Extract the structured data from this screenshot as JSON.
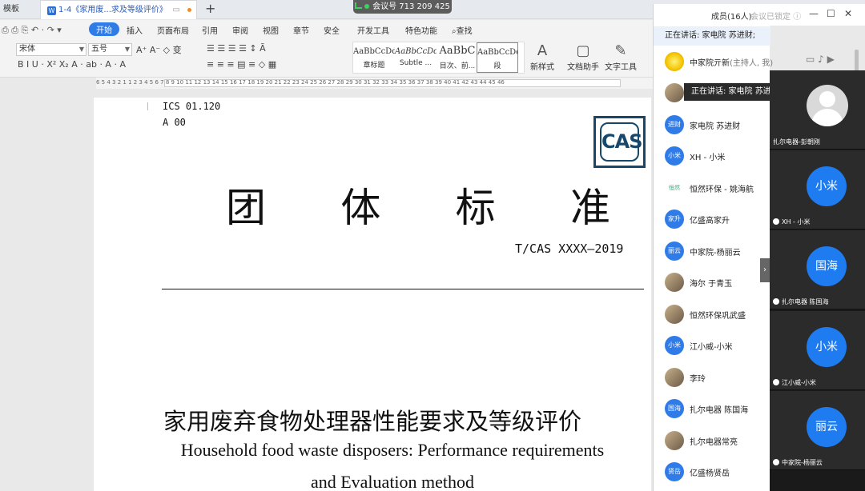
{
  "tabs": {
    "template": "模板",
    "doc": "1-4《家用废...求及等级评价》",
    "new_tab": "+"
  },
  "meeting": {
    "label": "会议号 713 209 425"
  },
  "menu": [
    "开始",
    "插入",
    "页面布局",
    "引用",
    "审阅",
    "视图",
    "章节",
    "安全",
    "开发工具",
    "特色功能",
    "查找"
  ],
  "ribbon": {
    "font_name": "宋体",
    "font_size": "五号",
    "styles": [
      {
        "sample": "AaBbCcDd",
        "name": "章标题"
      },
      {
        "sample": "AaBbCcDd",
        "name": "Subtle ..."
      },
      {
        "sample": "AaBbC",
        "name": "目次、前..."
      },
      {
        "sample": "AaBbCcDd",
        "name": "段"
      }
    ],
    "new_style": "新样式",
    "doc_helper": "文档助手",
    "text_tools": "文字工具"
  },
  "ruler": "6 5 4 3 2 1  1 2 3 4 5 6 7 8 9 10 11 12 13 14 15 16 17 18 19 20 21 22 23 24 25 26 27 28 29 30 31 32 33 34 35 36 37 38 39 40 41 42 43 44 45 46",
  "document": {
    "ics": "ICS 01.120",
    "class_code": "A 00",
    "logo_text": "CAS",
    "title_chars": [
      "团",
      "体",
      "标",
      "准"
    ],
    "std_no": "T/CAS XXXX—2019",
    "zh_title": "家用废弃食物处理器性能要求及等级评价",
    "en_title_1": "Household food waste disposers: Performance requirements",
    "en_title_2": "and Evaluation method"
  },
  "panel": {
    "title": "成员(16人)",
    "locked": "会议已锁定",
    "speaking": "正在讲话: 家电院 苏进财;",
    "tooltip": "正在讲话: 家电院 苏进财;",
    "members": [
      {
        "av": "",
        "name": "中家院亓新",
        "host": "(主持人, 我)"
      },
      {
        "av": "",
        "name": ""
      },
      {
        "av": "进财",
        "name": "家电院 苏进财"
      },
      {
        "av": "小米",
        "name": "XH - 小米"
      },
      {
        "av": "恒然",
        "name": "恒然环保 - 姚海航"
      },
      {
        "av": "家升",
        "name": "亿盛高家升"
      },
      {
        "av": "丽云",
        "name": "中家院-杨丽云"
      },
      {
        "av": "",
        "name": "海尔 于青玉"
      },
      {
        "av": "",
        "name": "恒然环保巩武盛"
      },
      {
        "av": "小米",
        "name": "江小威-小米"
      },
      {
        "av": "",
        "name": "李玲"
      },
      {
        "av": "国海",
        "name": "扎尔电器 陈国海"
      },
      {
        "av": "",
        "name": "扎尔电器常亮"
      },
      {
        "av": "贤岳",
        "name": "亿盛杨贤岳"
      }
    ]
  },
  "video": {
    "tiles": [
      {
        "av": "",
        "label": "扎尔电器-彭朝刚"
      },
      {
        "av": "小米",
        "label": "XH - 小米"
      },
      {
        "av": "国海",
        "label": "扎尔电器 陈国海"
      },
      {
        "av": "小米",
        "label": "江小威-小米"
      },
      {
        "av": "丽云",
        "label": "中家院-杨丽云"
      }
    ]
  }
}
